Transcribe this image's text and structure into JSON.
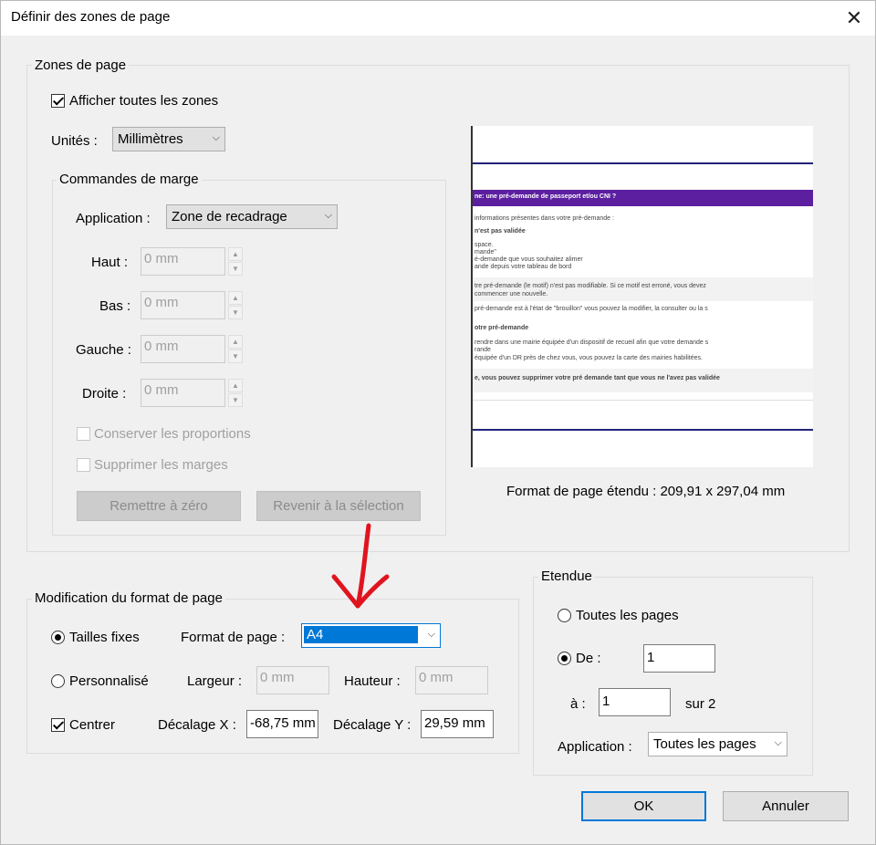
{
  "window": {
    "title": "Définir des zones de page",
    "close_glyph": "✕"
  },
  "zones": {
    "legend": "Zones de page",
    "show_all_label": "Afficher toutes les zones",
    "show_all_checked": true,
    "units_label": "Unités :",
    "units_value": "Millimètres"
  },
  "margins": {
    "legend": "Commandes de marge",
    "application_label": "Application :",
    "application_value": "Zone de recadrage",
    "top_label": "Haut :",
    "top_value": "0 mm",
    "bottom_label": "Bas :",
    "bottom_value": "0 mm",
    "left_label": "Gauche :",
    "left_value": "0 mm",
    "right_label": "Droite :",
    "right_value": "0 mm",
    "keep_proportions_label": "Conserver les proportions",
    "remove_margins_label": "Supprimer les marges",
    "reset_label": "Remettre à zéro",
    "revert_label": "Revenir à la sélection"
  },
  "preview": {
    "band_text": "ne: une pré-demande de passeport et/ou CNI ?",
    "lines": [
      "informations présentes dans votre pré-demande :",
      "n'est pas validée",
      "space.",
      "mande\"",
      "é-demande que vous souhaitez alimer",
      "ande depuis votre tableau de bord",
      "tre pré-demande (le motif) n'est pas modifiable. Si ce motif est erroné, vous devez",
      "commencer une nouvelle.",
      "pré-demande est à l'état de \"brouillon\" vous pouvez la modifier, la consulter ou la s",
      "otre pré-demande",
      "rendre dans une mairie équipée d'un dispositif de recueil afin que votre demande s",
      "rande",
      "équipée d'un DR près de chez vous, vous pouvez la carte des mairies habilitées.",
      "e, vous pouvez supprimer votre pré demande tant que vous ne l'avez pas validée"
    ],
    "extended_format_label": "Format de page étendu : 209,91 x 297,04 mm"
  },
  "format": {
    "legend": "Modification du format de page",
    "fixed_sizes_label": "Tailles fixes",
    "fixed_sizes_checked": true,
    "page_format_label": "Format de page :",
    "page_format_value": "A4",
    "custom_label": "Personnalisé",
    "width_label": "Largeur :",
    "width_value": "0 mm",
    "height_label": "Hauteur :",
    "height_value": "0 mm",
    "center_label": "Centrer",
    "center_checked": true,
    "offset_x_label": "Décalage X :",
    "offset_x_value": "-68,75 mm",
    "offset_y_label": "Décalage Y :",
    "offset_y_value": "29,59 mm"
  },
  "range": {
    "legend": "Etendue",
    "all_pages_label": "Toutes les pages",
    "from_label": "De :",
    "from_value": "1",
    "to_label": "à :",
    "to_value": "1",
    "of_label": "sur 2",
    "application_label": "Application :",
    "application_value": "Toutes les pages"
  },
  "buttons": {
    "ok_label": "OK",
    "cancel_label": "Annuler"
  },
  "colors": {
    "accent": "#0078d7",
    "annotation_arrow": "#e0141e"
  }
}
